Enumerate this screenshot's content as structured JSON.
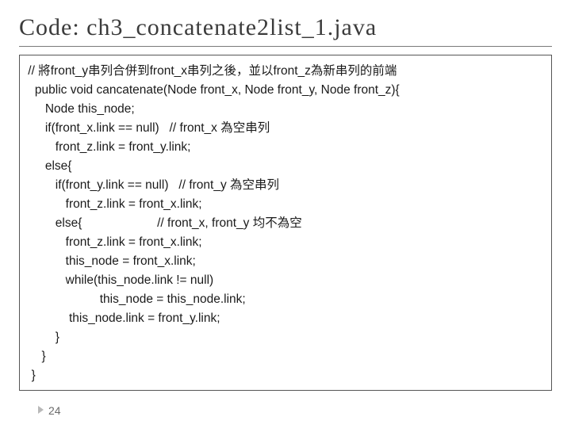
{
  "title": "Code: ch3_concatenate2list_1.java",
  "code": {
    "l0": " // 將front_y串列合併到front_x串列之後，並以front_z為新串列的前端",
    "l1": "   public void cancatenate(Node front_x, Node front_y, Node front_z){",
    "l2": "      Node this_node;",
    "l3": "      if(front_x.link == null)   // front_x 為空串列",
    "l4": "         front_z.link = front_y.link;",
    "l5": "      else{",
    "l6": "         if(front_y.link == null)   // front_y 為空串列",
    "l7": "            front_z.link = front_x.link;",
    "l8": "         else{                      // front_x, front_y 均不為空",
    "l9": "            front_z.link = front_x.link;",
    "l10": "            this_node = front_x.link;",
    "l11": "            while(this_node.link != null)",
    "l12": "                      this_node = this_node.link;",
    "l13": "             this_node.link = front_y.link;",
    "l14": "         }",
    "l15": "     }",
    "l16": "  }"
  },
  "page_number": "24"
}
